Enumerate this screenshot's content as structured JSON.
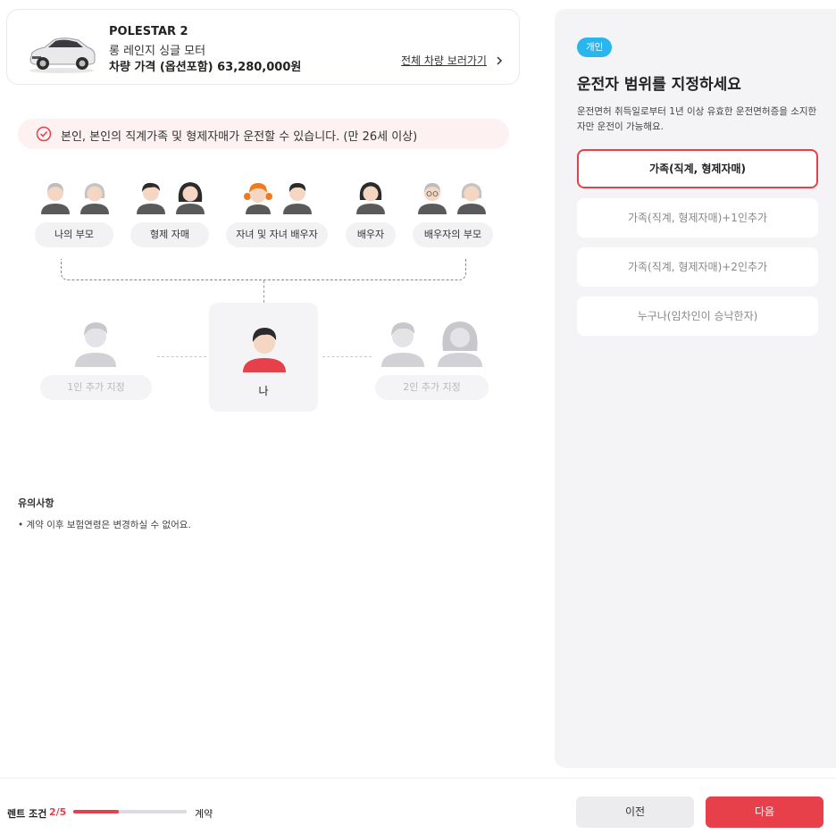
{
  "car": {
    "model": "POLESTAR 2",
    "trim": "롱 레인지 싱글 모터",
    "price_text": "차량 가격 (옵션포함) 63,280,000원",
    "all_cars_link": "전체 차량 보러가기"
  },
  "notice": {
    "text": "본인, 본인의 직계가족 및 형제자매가 운전할 수 있습니다. (만 26세 이상)"
  },
  "family_groups": [
    {
      "label": "나의 부모"
    },
    {
      "label": "형제 자매"
    },
    {
      "label": "자녀 및 자녀 배우자"
    },
    {
      "label": "배우자"
    },
    {
      "label": "배우자의 부모"
    }
  ],
  "center": {
    "me_label": "나",
    "left_label": "1인 추가 지정",
    "right_label": "2인 추가 지정"
  },
  "notes": {
    "title": "유의사항",
    "items": [
      "• 계약 이후 보험연령은 변경하실 수 없어요."
    ]
  },
  "panel": {
    "badge": "개인",
    "title": "운전자 범위를 지정하세요",
    "description": "운전면허 취득일로부터 1년 이상 유효한 운전면허증을 소지한 자만 운전이 가능해요.",
    "options": [
      {
        "label": "가족(직계, 형제자매)",
        "selected": true
      },
      {
        "label": "가족(직계, 형제자매)+1인추가",
        "selected": false
      },
      {
        "label": "가족(직계, 형제자매)+2인추가",
        "selected": false
      },
      {
        "label": "누구나(임차인이 승낙한자)",
        "selected": false
      }
    ]
  },
  "footer": {
    "step_label": "렌트 조건",
    "step_value": "2/5",
    "progress": 0.4,
    "next_step_label": "계약",
    "prev_button": "이전",
    "next_button": "다음"
  },
  "colors": {
    "accent": "#e8404a",
    "badge": "#29b6ef",
    "panel_bg": "#f4f4f6"
  }
}
